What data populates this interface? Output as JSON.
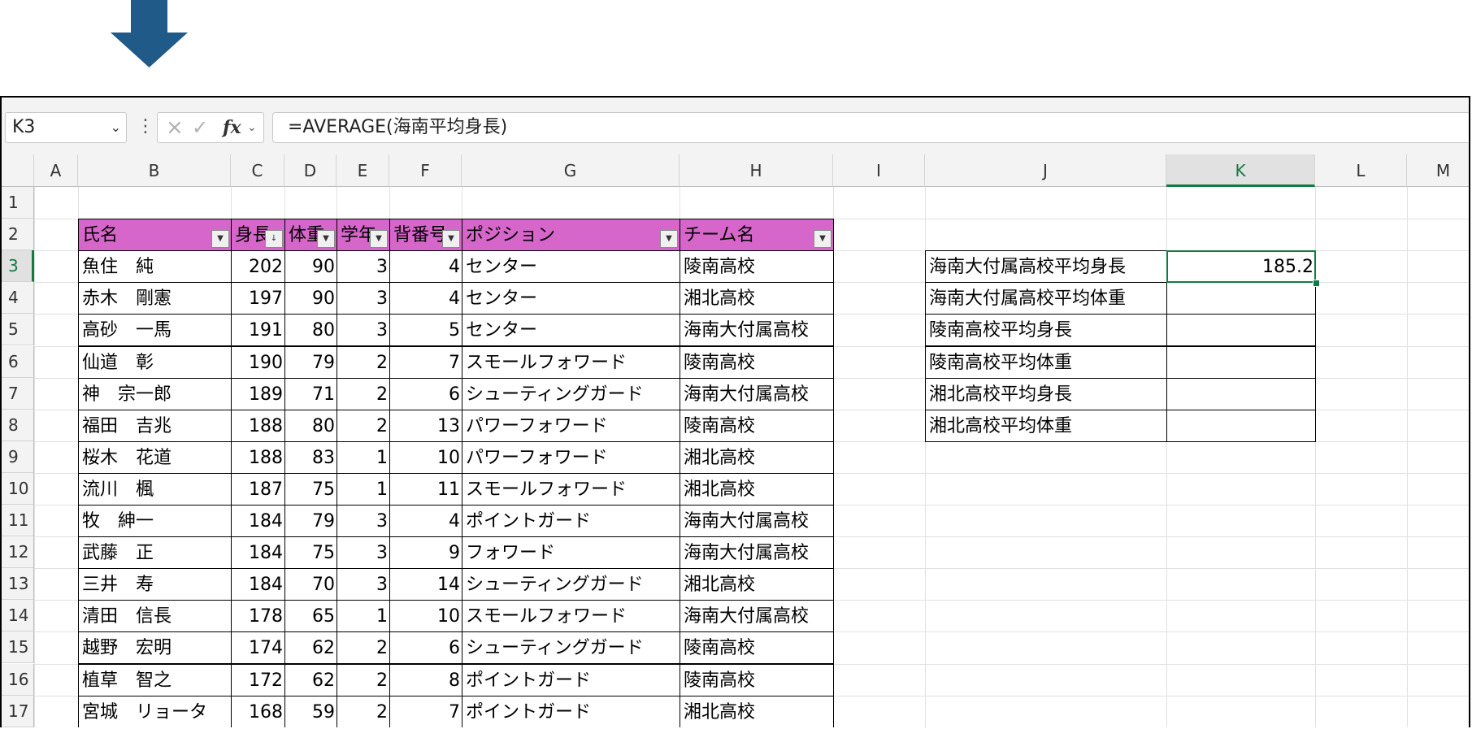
{
  "colors": {
    "header_fill": "#d666c9",
    "accent": "#107c41",
    "arrow": "#1f5a88"
  },
  "formula_bar": {
    "name_box": "K3",
    "formula": "=AVERAGE(海南平均身長)",
    "cancel_icon": "×",
    "enter_icon": "✓",
    "fx_label": "fx"
  },
  "columns": [
    "A",
    "B",
    "C",
    "D",
    "E",
    "F",
    "G",
    "H",
    "I",
    "J",
    "K",
    "L",
    "M"
  ],
  "rows": [
    "1",
    "2",
    "3",
    "4",
    "5",
    "6",
    "7",
    "8",
    "9",
    "10",
    "11",
    "12",
    "13",
    "14",
    "15",
    "16",
    "17"
  ],
  "table": {
    "headers": [
      "氏名",
      "身長",
      "体重",
      "学年",
      "背番号",
      "ポジション",
      "チーム名"
    ],
    "rows": [
      [
        "魚住　純",
        "202",
        "90",
        "3",
        "4",
        "センター",
        "陵南高校"
      ],
      [
        "赤木　剛憲",
        "197",
        "90",
        "3",
        "4",
        "センター",
        "湘北高校"
      ],
      [
        "高砂　一馬",
        "191",
        "80",
        "3",
        "5",
        "センター",
        "海南大付属高校"
      ],
      [
        "仙道　彰",
        "190",
        "79",
        "2",
        "7",
        "スモールフォワード",
        "陵南高校"
      ],
      [
        "神　宗一郎",
        "189",
        "71",
        "2",
        "6",
        "シューティングガード",
        "海南大付属高校"
      ],
      [
        "福田　吉兆",
        "188",
        "80",
        "2",
        "13",
        "パワーフォワード",
        "陵南高校"
      ],
      [
        "桜木　花道",
        "188",
        "83",
        "1",
        "10",
        "パワーフォワード",
        "湘北高校"
      ],
      [
        "流川　楓",
        "187",
        "75",
        "1",
        "11",
        "スモールフォワード",
        "湘北高校"
      ],
      [
        "牧　紳一",
        "184",
        "79",
        "3",
        "4",
        "ポイントガード",
        "海南大付属高校"
      ],
      [
        "武藤　正",
        "184",
        "75",
        "3",
        "9",
        "フォワード",
        "海南大付属高校"
      ],
      [
        "三井　寿",
        "184",
        "70",
        "3",
        "14",
        "シューティングガード",
        "湘北高校"
      ],
      [
        "清田　信長",
        "178",
        "65",
        "1",
        "10",
        "スモールフォワード",
        "海南大付属高校"
      ],
      [
        "越野　宏明",
        "174",
        "62",
        "2",
        "6",
        "シューティングガード",
        "陵南高校"
      ],
      [
        "植草　智之",
        "172",
        "62",
        "2",
        "8",
        "ポイントガード",
        "陵南高校"
      ],
      [
        "宮城　リョータ",
        "168",
        "59",
        "2",
        "7",
        "ポイントガード",
        "湘北高校"
      ]
    ]
  },
  "summary": [
    {
      "label": "海南大付属高校平均身長",
      "value": "185.2"
    },
    {
      "label": "海南大付属高校平均体重",
      "value": ""
    },
    {
      "label": "陵南高校平均身長",
      "value": ""
    },
    {
      "label": "陵南高校平均体重",
      "value": ""
    },
    {
      "label": "湘北高校平均身長",
      "value": ""
    },
    {
      "label": "湘北高校平均体重",
      "value": ""
    }
  ]
}
